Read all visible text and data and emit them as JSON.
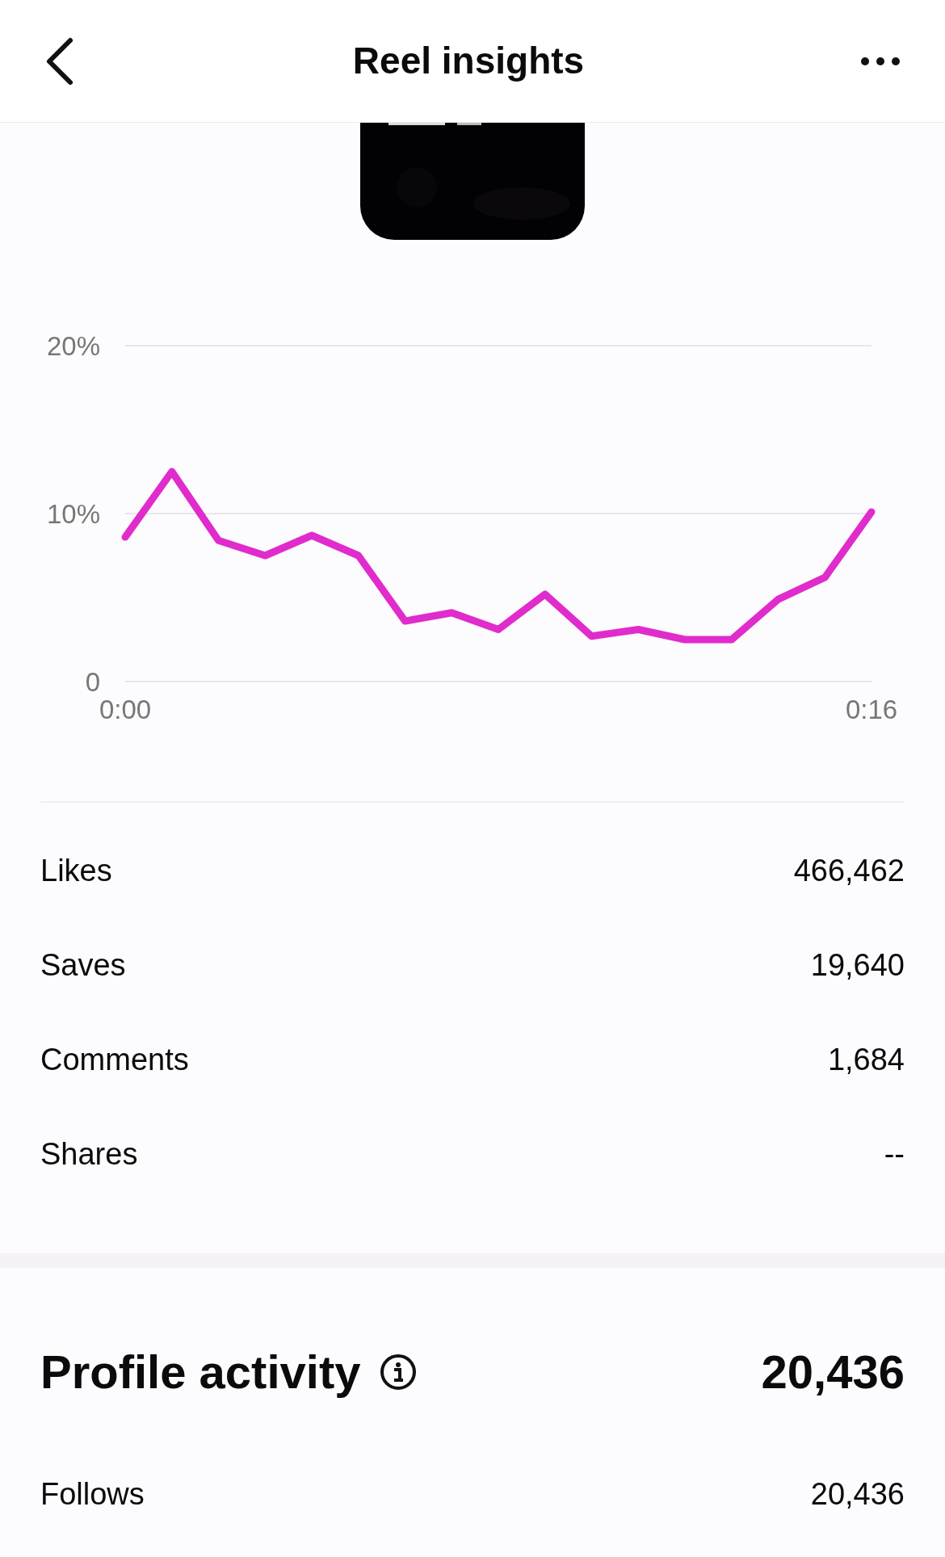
{
  "header": {
    "title": "Reel insights"
  },
  "chart": {
    "chart_data": {
      "type": "line",
      "x": [
        0,
        1,
        2,
        3,
        4,
        5,
        6,
        7,
        8,
        9,
        10,
        11,
        12,
        13,
        14,
        15,
        16
      ],
      "xlim": [
        0,
        16
      ],
      "ylim": [
        0,
        20
      ],
      "xticks": [
        {
          "value": 0,
          "label": "0:00"
        },
        {
          "value": 16,
          "label": "0:16"
        }
      ],
      "yticks": [
        {
          "value": 0,
          "label": "0"
        },
        {
          "value": 10,
          "label": "10%"
        },
        {
          "value": 20,
          "label": "20%"
        }
      ],
      "series": [
        {
          "color": "#e02ccc",
          "values": [
            8.6,
            12.5,
            8.4,
            7.5,
            8.7,
            7.5,
            3.6,
            4.1,
            3.1,
            5.2,
            2.7,
            3.1,
            2.5,
            2.5,
            4.9,
            6.2,
            10.1
          ]
        }
      ]
    }
  },
  "metrics": [
    {
      "label": "Likes",
      "value": "466,462"
    },
    {
      "label": "Saves",
      "value": "19,640"
    },
    {
      "label": "Comments",
      "value": "1,684"
    },
    {
      "label": "Shares",
      "value": "--"
    }
  ],
  "profile_activity": {
    "title": "Profile activity",
    "value": "20,436",
    "rows": [
      {
        "label": "Follows",
        "value": "20,436"
      }
    ]
  }
}
